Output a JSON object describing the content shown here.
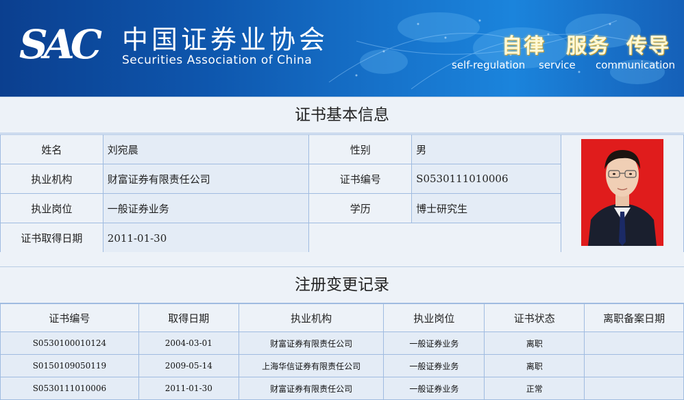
{
  "banner": {
    "logo": "SAC",
    "org_name_cn": "中国证券业协会",
    "org_name_en": "Securities Association of China",
    "slogans": [
      {
        "cn": "自律",
        "en": "self-regulation"
      },
      {
        "cn": "服务",
        "en": "service"
      },
      {
        "cn": "传导",
        "en": "communication"
      }
    ]
  },
  "basic_info": {
    "title": "证书基本信息",
    "name_label": "姓名",
    "name_value": "刘宛晨",
    "gender_label": "性别",
    "gender_value": "男",
    "org_label": "执业机构",
    "org_value": "财富证券有限责任公司",
    "cert_no_label": "证书编号",
    "cert_no_value": "S0530111010006",
    "position_label": "执业岗位",
    "position_value": "一般证券业务",
    "education_label": "学历",
    "education_value": "博士研究生",
    "cert_date_label": "证书取得日期",
    "cert_date_value": "2011-01-30"
  },
  "records": {
    "title": "注册变更记录",
    "columns": [
      "证书编号",
      "取得日期",
      "执业机构",
      "执业岗位",
      "证书状态",
      "离职备案日期"
    ],
    "rows": [
      [
        "S0530100010124",
        "2004-03-01",
        "财富证券有限责任公司",
        "一般证券业务",
        "离职",
        ""
      ],
      [
        "S0150109050119",
        "2009-05-14",
        "上海华信证券有限责任公司",
        "一般证券业务",
        "离职",
        ""
      ],
      [
        "S0530111010006",
        "2011-01-30",
        "财富证券有限责任公司",
        "一般证券业务",
        "正常",
        ""
      ]
    ]
  },
  "colors": {
    "banner_dark": "#0b3f8f",
    "banner_light": "#1b84dc",
    "cell_border": "#9fbbe0",
    "label_bg": "#edf2f8",
    "value_bg": "#e4ecf6",
    "photo_bg": "#e21a1a"
  }
}
